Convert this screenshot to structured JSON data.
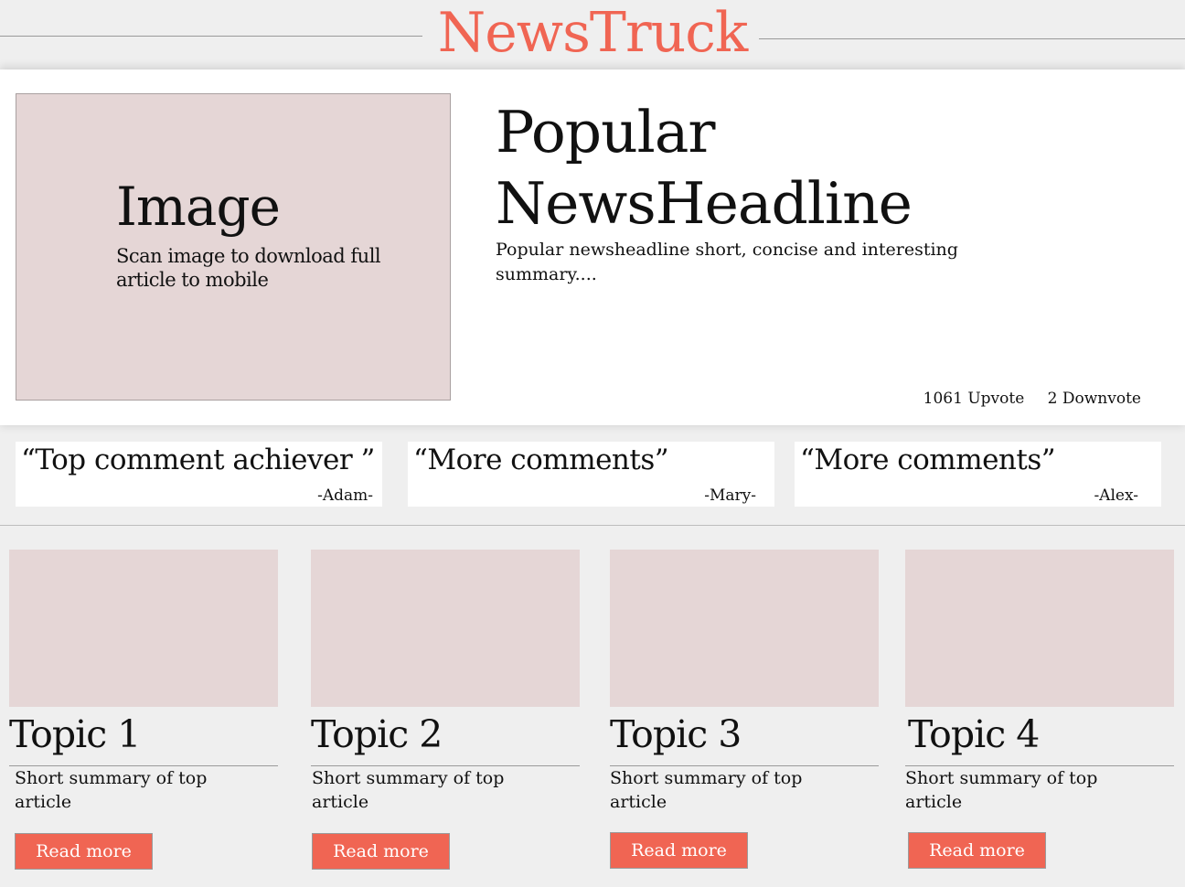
{
  "header": {
    "brand": "NewsTruck"
  },
  "hero": {
    "image_title": "Image",
    "image_caption": "Scan image to download full article to mobile",
    "headline": "Popular NewsHeadline",
    "summary": "Popular newsheadline short, concise and interesting summary....",
    "upvotes": "1061 Upvote",
    "downvotes": "2 Downvote"
  },
  "comments": [
    {
      "text": "“Top comment achiever ”",
      "author": "-Adam-"
    },
    {
      "text": "“More comments”",
      "author": "-Mary-"
    },
    {
      "text": "“More comments”",
      "author": "-Alex-"
    }
  ],
  "topics": [
    {
      "title": "Topic 1",
      "summary": "Short summary of top article",
      "button": "Read more"
    },
    {
      "title": "Topic 2",
      "summary": "Short summary of top article",
      "button": "Read more"
    },
    {
      "title": "Topic 3",
      "summary": "Short summary of top article",
      "button": "Read more"
    },
    {
      "title": "Topic 4",
      "summary": "Short summary of top article",
      "button": "Read more"
    }
  ],
  "colors": {
    "accent": "#f06553",
    "image_placeholder": "#e5d6d6",
    "page_background": "#efefef"
  }
}
